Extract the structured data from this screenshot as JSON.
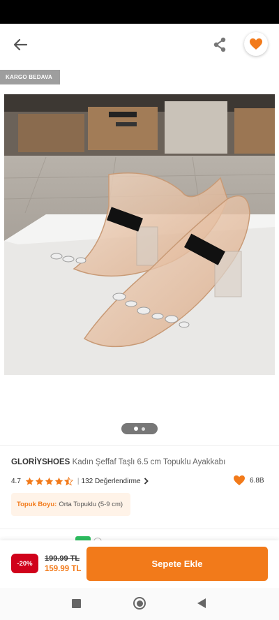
{
  "header": {
    "back_icon": "arrow-left-icon",
    "share_icon": "share-icon",
    "favorite_icon": "heart-icon"
  },
  "badges": {
    "shipping": "KARGO BEDAVA"
  },
  "gallery": {
    "total_images": 2,
    "current_index": 1
  },
  "product": {
    "brand": "GLORİYSHOES",
    "name": "Kadın Şeffaf Taşlı 6.5 cm Topuklu Ayakkabı",
    "rating": "4.7",
    "rating_stars": 4.5,
    "reviews_text": "132 Değerlendirme",
    "favorite_count": "6.8B"
  },
  "attribute": {
    "key": "Topuk Boyu:",
    "value": "Orta Topuklu (5-9 cm)"
  },
  "purchase": {
    "discount": "-20%",
    "old_price": "199.99 TL",
    "new_price": "159.99 TL",
    "add_to_cart": "Sepete Ekle"
  },
  "colors": {
    "accent": "#f27a1a",
    "discount": "#d0021b",
    "star": "#f27a1a",
    "badge_bg": "#9e9e9e",
    "attribute_bg": "#fff3e8"
  }
}
